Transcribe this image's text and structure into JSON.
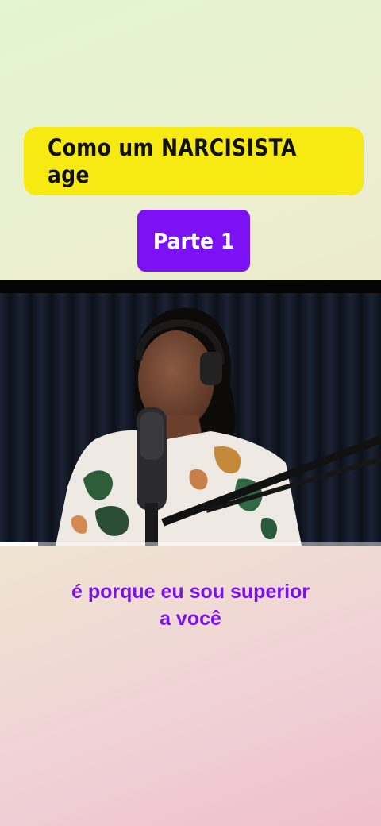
{
  "title": "Como um NARCISISTA age",
  "part_label": "Parte 1",
  "caption_lines": [
    "é porque eu sou superior",
    "a você"
  ],
  "video": {
    "progress_fraction": 0.1
  },
  "colors": {
    "title_bg": "#f6ea12",
    "part_bg": "#7d11f5",
    "caption": "#7a12e8"
  }
}
